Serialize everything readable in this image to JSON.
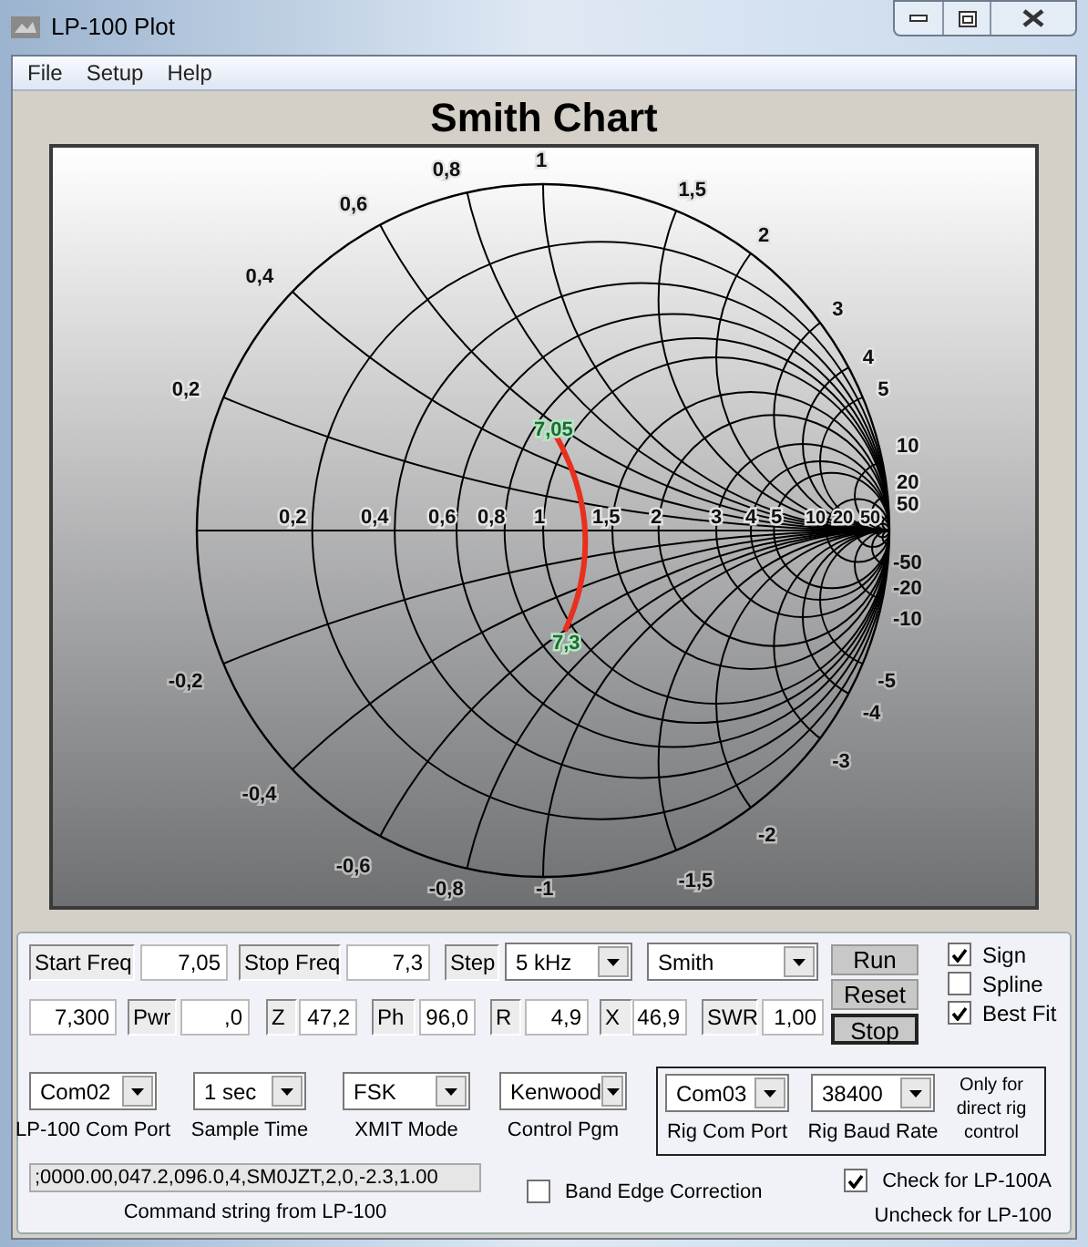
{
  "window": {
    "title": "LP-100 Plot"
  },
  "menu": [
    "File",
    "Setup",
    "Help"
  ],
  "chart": {
    "title": "Smith Chart",
    "resistance_labels": [
      "0,2",
      "0,4",
      "0,6",
      "0,8",
      "1",
      "1,5",
      "2",
      "3",
      "4",
      "5",
      "10",
      "20",
      "50"
    ],
    "reactance_labels_positive": [
      "0,2",
      "0,4",
      "0,6",
      "0,8",
      "1",
      "1,5",
      "2",
      "3",
      "4",
      "5",
      "10",
      "20",
      "50"
    ],
    "reactance_labels_negative": [
      "-0,2",
      "-0,4",
      "-0,6",
      "-0,8",
      "-1",
      "-1,5",
      "-2",
      "-3",
      "-4",
      "-5",
      "-50",
      "-20",
      "-10"
    ],
    "trace_labels": [
      "7,05",
      "7,3"
    ]
  },
  "sweep_row": [
    {
      "kind": "label",
      "text": "Start Freq"
    },
    {
      "kind": "value",
      "text": "7,05"
    },
    {
      "kind": "label",
      "text": "Stop Freq"
    },
    {
      "kind": "value",
      "text": "7,3"
    },
    {
      "kind": "label",
      "text": "Step"
    },
    {
      "kind": "select",
      "text": "5 kHz"
    },
    {
      "kind": "select",
      "text": "Smith"
    }
  ],
  "reading_row": [
    {
      "kind": "value",
      "text": "7,300"
    },
    {
      "kind": "label",
      "text": "Pwr"
    },
    {
      "kind": "value",
      "text": ",0"
    },
    {
      "kind": "label",
      "text": "Z"
    },
    {
      "kind": "value",
      "text": "47,2"
    },
    {
      "kind": "label",
      "text": "Ph"
    },
    {
      "kind": "value",
      "text": "96,0"
    },
    {
      "kind": "label",
      "text": "R"
    },
    {
      "kind": "value",
      "text": "4,9"
    },
    {
      "kind": "label",
      "text": "X"
    },
    {
      "kind": "value",
      "text": "46,9"
    },
    {
      "kind": "label",
      "text": "SWR"
    },
    {
      "kind": "value",
      "text": "1,00"
    }
  ],
  "buttons": [
    {
      "label": "Run",
      "focused": false
    },
    {
      "label": "Reset",
      "focused": false
    },
    {
      "label": "Stop",
      "focused": true
    }
  ],
  "options": [
    {
      "label": "Sign",
      "checked": true
    },
    {
      "label": "Spline",
      "checked": false
    },
    {
      "label": "Best Fit",
      "checked": true
    }
  ],
  "settings": [
    {
      "value": "Com02",
      "caption": "LP-100 Com Port"
    },
    {
      "value": "1 sec",
      "caption": "Sample Time"
    },
    {
      "value": "FSK",
      "caption": "XMIT Mode"
    },
    {
      "value": "Kenwood",
      "caption": "Control Pgm"
    }
  ],
  "rig_settings": [
    {
      "value": "Com03",
      "caption": "Rig Com Port"
    },
    {
      "value": "38400",
      "caption": "Rig Baud Rate"
    }
  ],
  "rig_note": "Only for direct rig control",
  "command": {
    "value": ";0000.00,047.2,096.0,4,SM0JZT,2,0,-2.3,1.00",
    "caption": "Command string from LP-100"
  },
  "band_edge": {
    "label": "Band Edge Correction",
    "checked": false
  },
  "model_check": {
    "label": "Check for LP-100A",
    "checked": true,
    "hint": "Uncheck for LP-100"
  }
}
